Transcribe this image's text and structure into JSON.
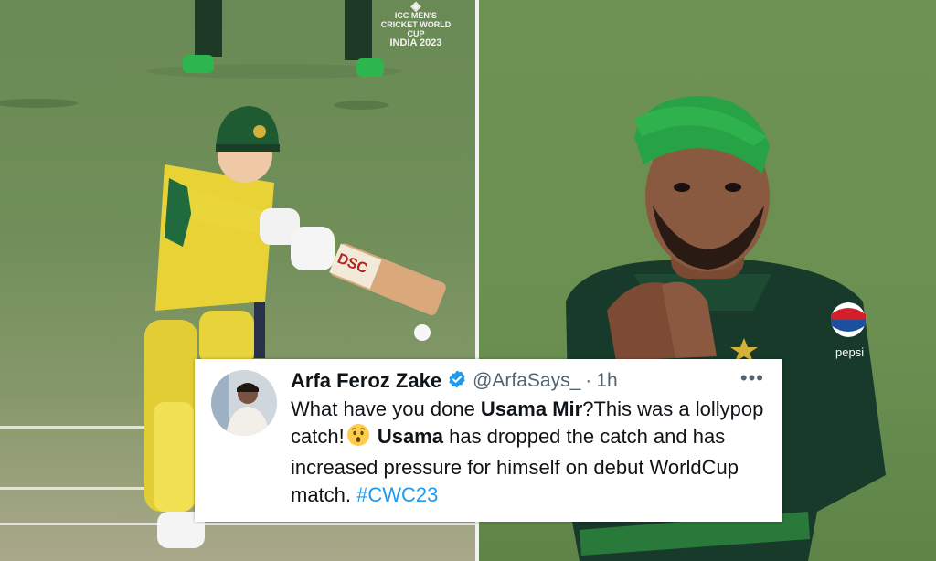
{
  "broadcast_logo": {
    "line1": "ICC MEN'S",
    "line2": "CRICKET WORLD CUP",
    "line3": "INDIA 2023"
  },
  "bat_sticker": "DSC",
  "shirt_logo": "pepsi",
  "tweet": {
    "author_name": "Arfa Feroz Zake",
    "handle": "@ArfaSays_",
    "separator": "·",
    "time": "1h",
    "more_label": "•••",
    "text": {
      "part1": "What have you done ",
      "mention_bold_1": "Usama Mir",
      "part2": "?This was a lollypop catch!",
      "emoji": "hushed-face",
      "mention_bold_2": "Usama",
      "part3": " has dropped the catch and has increased pressure for himself on debut WorldCup match. ",
      "hashtag": "#CWC23"
    },
    "colors": {
      "verified": "#1d9bf0",
      "hashtag": "#1d9bf0",
      "secondary": "#536471"
    }
  }
}
